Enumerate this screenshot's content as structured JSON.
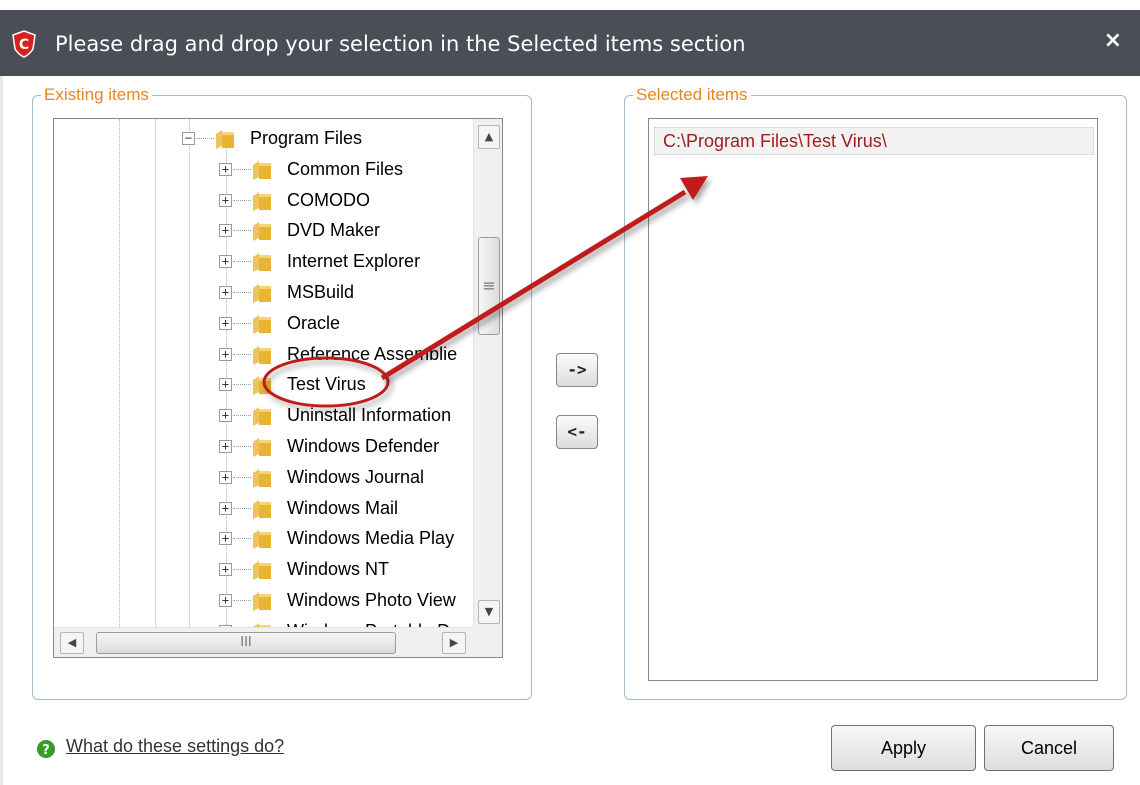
{
  "window": {
    "title": "Please drag and drop your selection in the Selected items section",
    "close_glyph": "×",
    "icon": "comodo-shield-icon"
  },
  "existing": {
    "legend": "Existing items",
    "tree": {
      "parent": {
        "label": "Program Files",
        "expander": "−"
      },
      "children": [
        {
          "label": "Common Files",
          "expander": "+"
        },
        {
          "label": "COMODO",
          "expander": "+"
        },
        {
          "label": "DVD Maker",
          "expander": "+"
        },
        {
          "label": "Internet Explorer",
          "expander": "+"
        },
        {
          "label": "MSBuild",
          "expander": "+"
        },
        {
          "label": "Oracle",
          "expander": "+"
        },
        {
          "label": "Reference Assemblie",
          "expander": "+"
        },
        {
          "label": "Test Virus",
          "expander": "+"
        },
        {
          "label": "Uninstall Information",
          "expander": "+"
        },
        {
          "label": "Windows Defender",
          "expander": "+"
        },
        {
          "label": "Windows Journal",
          "expander": "+"
        },
        {
          "label": "Windows Mail",
          "expander": "+"
        },
        {
          "label": "Windows Media Play",
          "expander": "+"
        },
        {
          "label": "Windows NT",
          "expander": "+"
        },
        {
          "label": "Windows Photo View",
          "expander": "+"
        },
        {
          "label": "Windows Portable D",
          "expander": "+"
        }
      ]
    },
    "vscroll": {
      "up": "▲",
      "down": "▼",
      "thumb": "≡"
    },
    "hscroll": {
      "left": "◀",
      "right": "▶",
      "thumb": "III"
    }
  },
  "selected": {
    "legend": "Selected items",
    "items": [
      "C:\\Program Files\\Test Virus\\"
    ]
  },
  "transfer": {
    "add_label": "->",
    "remove_label": "<-"
  },
  "footer": {
    "help_text": "What do these settings do?",
    "apply_label": "Apply",
    "cancel_label": "Cancel"
  },
  "colors": {
    "titlebar": "#4a4f57",
    "legend_text": "#e8851c",
    "annotation_red": "#c01e1e",
    "folder": "#e9b433",
    "help_icon": "#3a9a2a"
  }
}
